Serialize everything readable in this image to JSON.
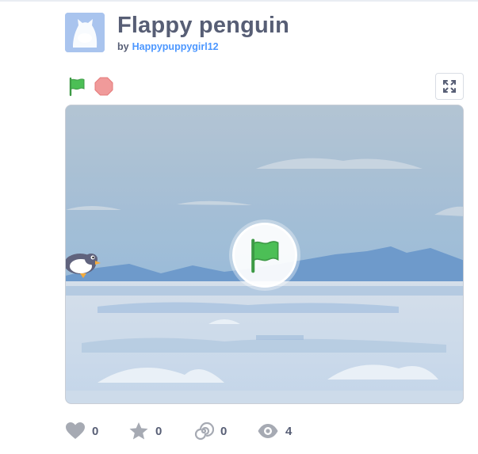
{
  "project": {
    "title": "Flappy penguin",
    "by_prefix": "by",
    "author": "Happypuppygirl12"
  },
  "controls": {
    "green_flag_icon": "green-flag-icon",
    "stop_icon": "stop-sign-icon",
    "fullscreen_icon": "fullscreen-expand-icon"
  },
  "stats": {
    "loves": "0",
    "favorites": "0",
    "remixes": "0",
    "views": "4"
  },
  "colors": {
    "title_text": "#575e75",
    "author_link": "#4c97ff",
    "green_flag": "#4cbf56",
    "stop_sign": "#ec5959",
    "stat_icon": "#a6aab3"
  }
}
